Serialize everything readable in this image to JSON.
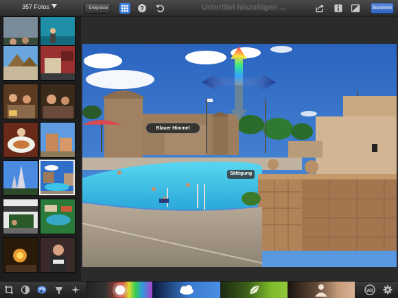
{
  "toolbar": {
    "photo_count": "357 Fotos",
    "events_label": "Ereignisse",
    "subtitle_placeholder": "Untertitel hinzufügen ...",
    "edit_label": "Bearbeiten"
  },
  "viewer": {
    "blue_sky_label": "Blauer Himmel",
    "saturation_label": "Sättigung"
  },
  "sidebar": {
    "thumbnail_count": 14,
    "selected_index": 9
  },
  "colors": {
    "accent_blue": "#3d7bd9",
    "sky_blue": "#2f6fc8",
    "pool_cyan": "#3ec4e6"
  }
}
